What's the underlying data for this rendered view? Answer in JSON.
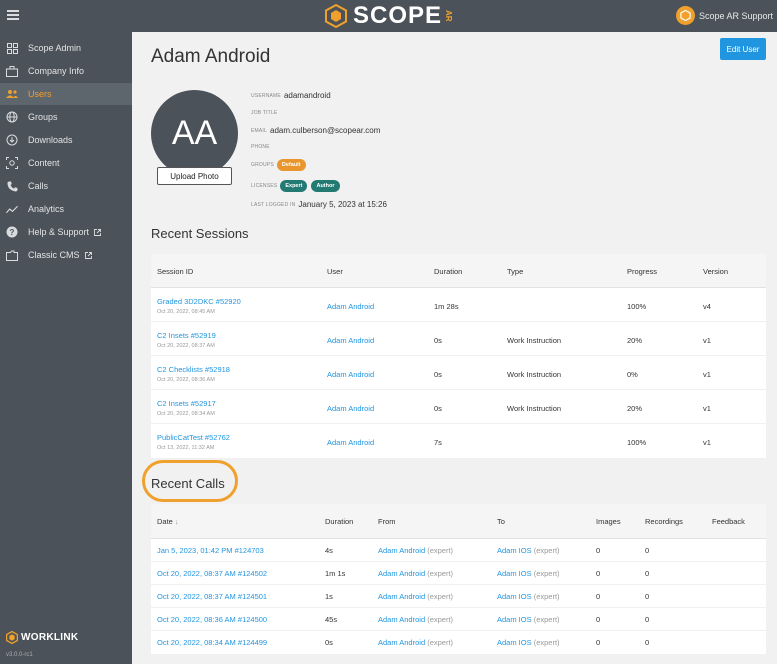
{
  "header": {
    "logo_text": "SCOPE",
    "logo_suffix": "AR",
    "account_name": "Scope AR Support"
  },
  "sidebar": {
    "items": [
      {
        "label": "Scope Admin",
        "icon": "grid-icon"
      },
      {
        "label": "Company Info",
        "icon": "briefcase-icon"
      },
      {
        "label": "Users",
        "icon": "users-icon"
      },
      {
        "label": "Groups",
        "icon": "globe-icon"
      },
      {
        "label": "Downloads",
        "icon": "download-icon"
      },
      {
        "label": "Content",
        "icon": "content-icon"
      },
      {
        "label": "Calls",
        "icon": "phone-icon"
      },
      {
        "label": "Analytics",
        "icon": "chart-line-icon"
      },
      {
        "label": "Help & Support",
        "icon": "help-icon"
      },
      {
        "label": "Classic CMS",
        "icon": "folder-icon"
      }
    ],
    "active_index": 2,
    "brand": "WORKLINK",
    "version": "v3.0.0-rc1"
  },
  "user": {
    "name": "Adam Android",
    "initials": "AA",
    "edit_label": "Edit User",
    "upload_label": "Upload Photo",
    "username_label": "Username",
    "username": "adamandroid",
    "job_title_label": "Job Title",
    "email_label": "Email",
    "email": "adam.culberson@scopear.com",
    "phone_label": "Phone",
    "groups_label": "Groups",
    "groups": [
      "Default"
    ],
    "licenses_label": "Licenses",
    "licenses": [
      "Expert",
      "Author"
    ],
    "last_logged_label": "Last logged in",
    "last_logged": "January 5, 2023 at 15:26"
  },
  "sessions": {
    "title": "Recent Sessions",
    "columns": [
      "Session ID",
      "User",
      "Duration",
      "Type",
      "Progress",
      "Version"
    ],
    "rows": [
      {
        "id": "Graded 3D2DKC #52920",
        "date": "Oct 20, 2022, 08:45 AM",
        "user": "Adam Android",
        "duration": "1m 28s",
        "type": "",
        "progress": "100%",
        "version": "v4"
      },
      {
        "id": "C2 Insets #52919",
        "date": "Oct 20, 2022, 08:37 AM",
        "user": "Adam Android",
        "duration": "0s",
        "type": "Work Instruction",
        "progress": "20%",
        "version": "v1"
      },
      {
        "id": "C2 Checklists #52918",
        "date": "Oct 20, 2022, 08:36 AM",
        "user": "Adam Android",
        "duration": "0s",
        "type": "Work Instruction",
        "progress": "0%",
        "version": "v1"
      },
      {
        "id": "C2 Insets #52917",
        "date": "Oct 20, 2022, 08:34 AM",
        "user": "Adam Android",
        "duration": "0s",
        "type": "Work Instruction",
        "progress": "20%",
        "version": "v1"
      },
      {
        "id": "PublicCatTest #52762",
        "date": "Oct 13, 2022, 11:32 AM",
        "user": "Adam Android",
        "duration": "7s",
        "type": "",
        "progress": "100%",
        "version": "v1"
      }
    ]
  },
  "calls": {
    "title": "Recent Calls",
    "columns": [
      "Date",
      "Duration",
      "From",
      "To",
      "Images",
      "Recordings",
      "Feedback"
    ],
    "rows": [
      {
        "date": "Jan 5, 2023, 01:42 PM",
        "id": "#124703",
        "duration": "4s",
        "from": "Adam Android",
        "from_role": "(expert)",
        "to": "Adam IOS",
        "to_role": "(expert)",
        "images": "0",
        "recordings": "0"
      },
      {
        "date": "Oct 20, 2022, 08:37 AM",
        "id": "#124502",
        "duration": "1m 1s",
        "from": "Adam Android",
        "from_role": "(expert)",
        "to": "Adam IOS",
        "to_role": "(expert)",
        "images": "0",
        "recordings": "0"
      },
      {
        "date": "Oct 20, 2022, 08:37 AM",
        "id": "#124501",
        "duration": "1s",
        "from": "Adam Android",
        "from_role": "(expert)",
        "to": "Adam IOS",
        "to_role": "(expert)",
        "images": "0",
        "recordings": "0"
      },
      {
        "date": "Oct 20, 2022, 08:36 AM",
        "id": "#124500",
        "duration": "45s",
        "from": "Adam Android",
        "from_role": "(expert)",
        "to": "Adam IOS",
        "to_role": "(expert)",
        "images": "0",
        "recordings": "0"
      },
      {
        "date": "Oct 20, 2022, 08:34 AM",
        "id": "#124499",
        "duration": "0s",
        "from": "Adam Android",
        "from_role": "(expert)",
        "to": "Adam IOS",
        "to_role": "(expert)",
        "images": "0",
        "recordings": "0"
      }
    ]
  },
  "colors": {
    "accent": "#f0a02c",
    "link": "#2196e0",
    "sidebar": "#4b5259",
    "teal": "#227a73"
  }
}
